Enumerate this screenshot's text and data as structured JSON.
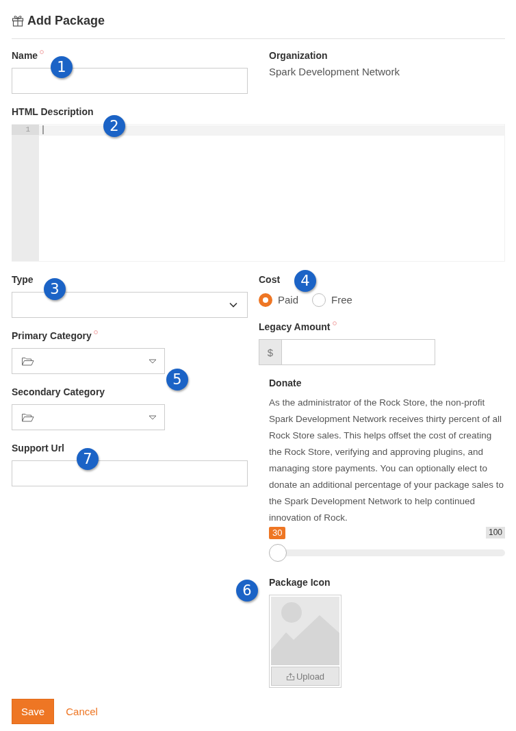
{
  "header": {
    "title": "Add Package"
  },
  "name": {
    "label": "Name",
    "required": true,
    "callout": "1"
  },
  "organization": {
    "label": "Organization",
    "value": "Spark Development Network"
  },
  "html_description": {
    "label": "HTML Description",
    "callout": "2",
    "lines": [
      {
        "number": "1",
        "active": true
      }
    ]
  },
  "type": {
    "label": "Type",
    "callout": "3"
  },
  "primary_category": {
    "label": "Primary Category",
    "required": true,
    "callout": "5"
  },
  "secondary_category": {
    "label": "Secondary Category"
  },
  "support_url": {
    "label": "Support Url",
    "callout": "7"
  },
  "cost": {
    "label": "Cost",
    "callout": "4",
    "options": [
      {
        "label": "Paid",
        "selected": true
      },
      {
        "label": "Free",
        "selected": false
      }
    ]
  },
  "legacy_amount": {
    "label": "Legacy Amount",
    "required": true,
    "prefix": "$"
  },
  "donate": {
    "label": "Donate",
    "text": "As the administrator of the Rock Store, the non-profit Spark Development Network receives thirty percent of all Rock Store sales. This helps offset the cost of creating the Rock Store, verifying and approving plugins, and managing store payments. You can optionally elect to donate an additional percentage of your package sales to the Spark Development Network to help continued innovation of Rock.",
    "slider": {
      "level": 0,
      "value_label": "30",
      "max_label": "100"
    }
  },
  "package_icon": {
    "label": "Package Icon",
    "callout": "6",
    "upload_label": "Upload"
  },
  "actions": [
    {
      "kind": "primary",
      "label": "Save"
    },
    {
      "kind": "link",
      "label": "Cancel"
    }
  ]
}
